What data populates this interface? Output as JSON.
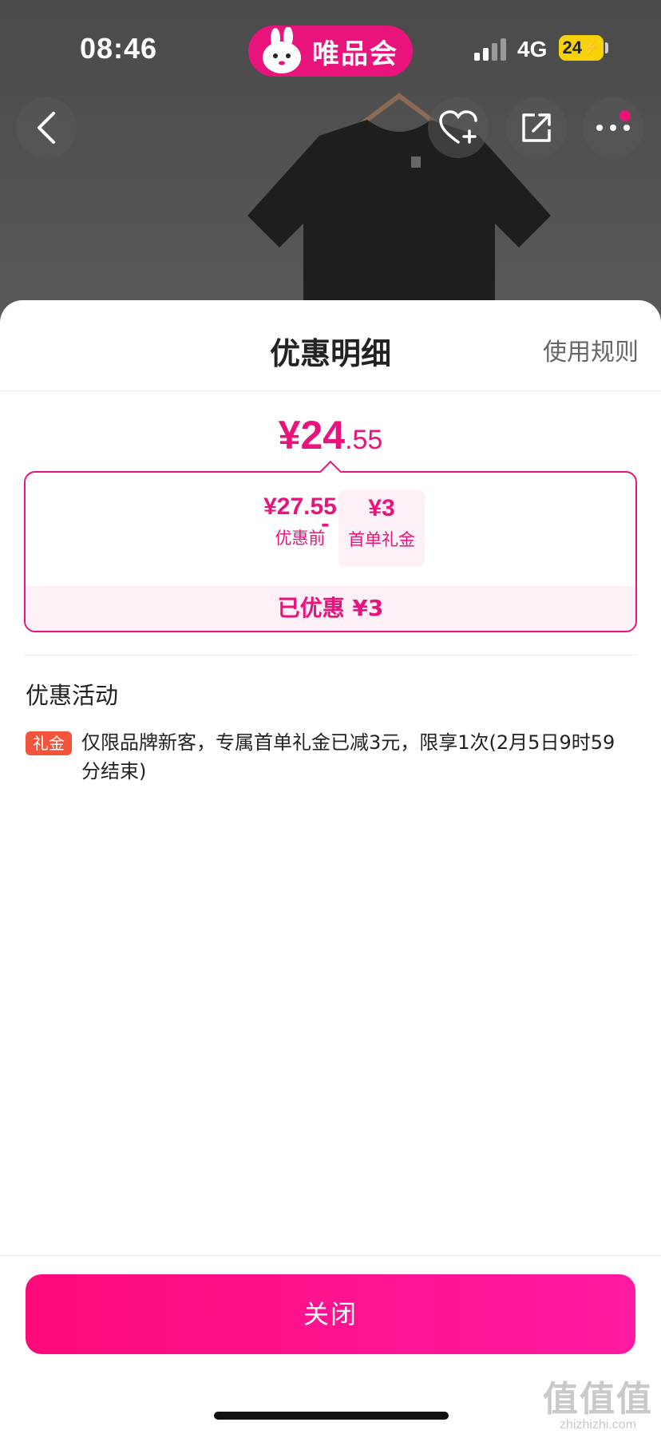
{
  "status_bar": {
    "time": "08:46",
    "network": "4G",
    "battery": "24"
  },
  "app": {
    "brand": "唯品会"
  },
  "top_actions": {
    "back_icon": "chevron-left-icon",
    "favorite_icon": "heart-plus-icon",
    "share_icon": "share-icon",
    "more_icon": "more-dots-icon"
  },
  "sheet": {
    "title": "优惠明细",
    "rules_link": "使用规则",
    "final_price": {
      "big": "¥24",
      "small": ".55"
    },
    "breakdown": {
      "before_amount": "¥27.55",
      "before_label": "优惠前",
      "minus": "-",
      "gift_amount": "¥3",
      "gift_label": "首单礼金",
      "saved": "已优惠 ¥3"
    },
    "section_title": "优惠活动",
    "promo": {
      "tag": "礼金",
      "text": "仅限品牌新客，专属首单礼金已减3元，限享1次(2月5日9时59分结束)"
    },
    "close_button": "关闭"
  },
  "watermark": {
    "big": "值值值",
    "small": "zhizhizhi.com"
  },
  "colors": {
    "brand_pink": "#e8137b",
    "tag_orange": "#f3553c",
    "button_gradient_start": "#ff0a7b",
    "button_gradient_end": "#ff1aa1"
  }
}
